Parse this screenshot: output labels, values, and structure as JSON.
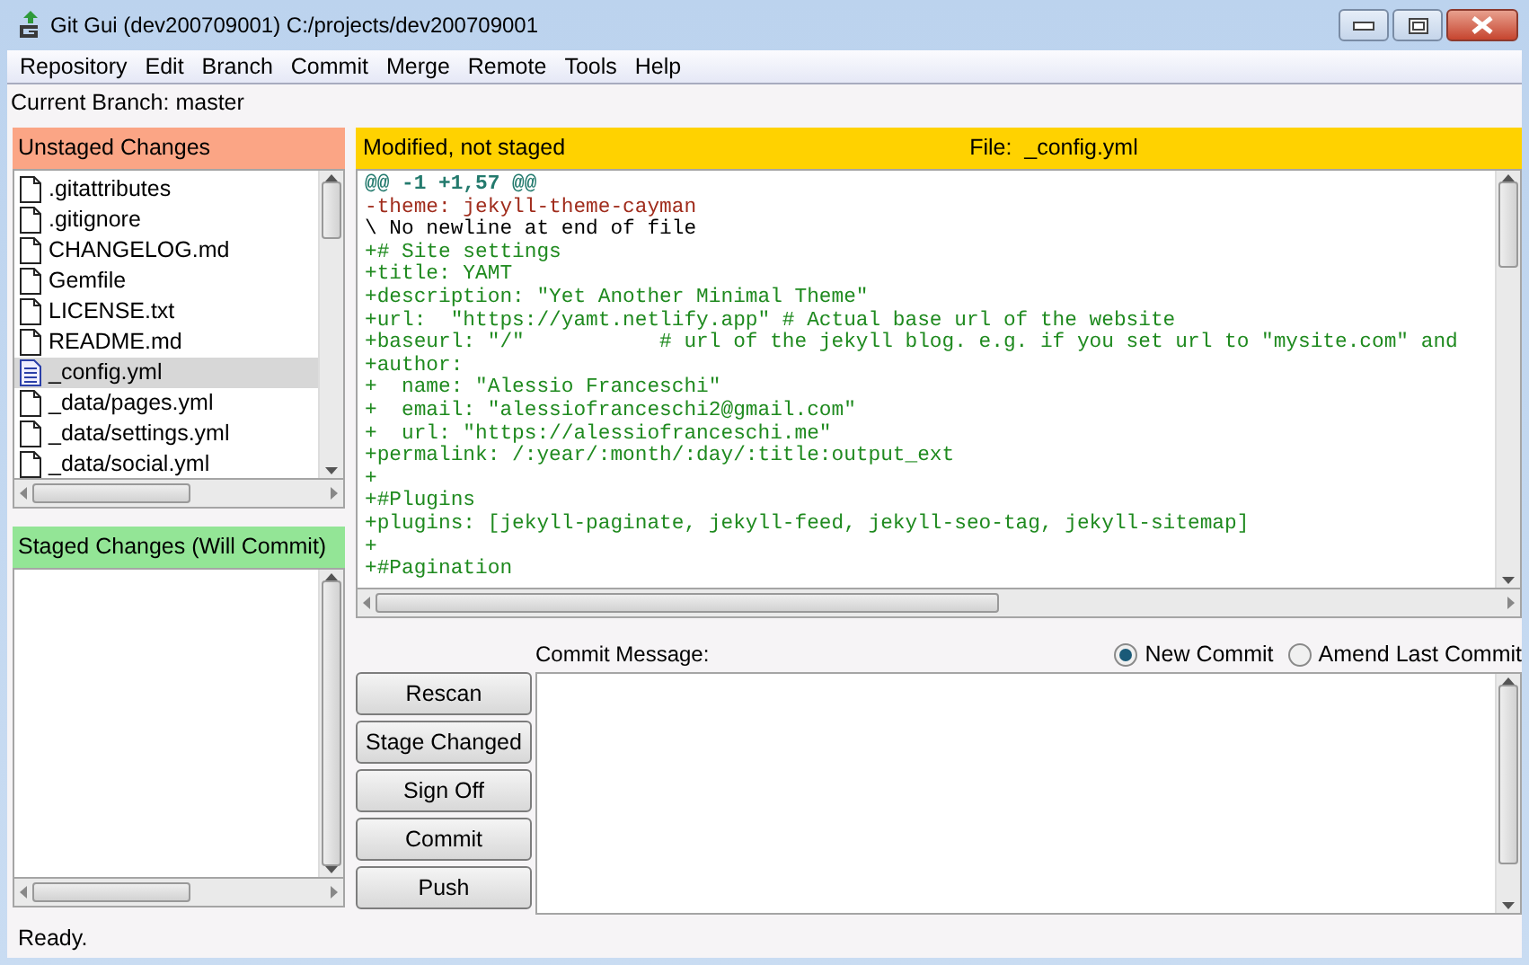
{
  "window": {
    "title": "Git Gui (dev200709001) C:/projects/dev200709001"
  },
  "menu": [
    "Repository",
    "Edit",
    "Branch",
    "Commit",
    "Merge",
    "Remote",
    "Tools",
    "Help"
  ],
  "current_branch": "Current Branch: master",
  "unstaged": {
    "title": "Unstaged Changes",
    "files": [
      {
        "name": ".gitattributes",
        "selected": false
      },
      {
        "name": ".gitignore",
        "selected": false
      },
      {
        "name": "CHANGELOG.md",
        "selected": false
      },
      {
        "name": "Gemfile",
        "selected": false
      },
      {
        "name": "LICENSE.txt",
        "selected": false
      },
      {
        "name": "README.md",
        "selected": false
      },
      {
        "name": "_config.yml",
        "selected": true
      },
      {
        "name": "_data/pages.yml",
        "selected": false
      },
      {
        "name": "_data/settings.yml",
        "selected": false
      },
      {
        "name": "_data/social.yml",
        "selected": false
      }
    ]
  },
  "staged": {
    "title": "Staged Changes (Will Commit)"
  },
  "diff": {
    "status": "Modified, not staged",
    "file_label": "File:",
    "file": "_config.yml",
    "lines": [
      {
        "kind": "hunk",
        "text": "@@ -1 +1,57 @@"
      },
      {
        "kind": "removed",
        "text": "-theme: jekyll-theme-cayman"
      },
      {
        "kind": "context",
        "text": "\\ No newline at end of file"
      },
      {
        "kind": "added",
        "text": "+# Site settings"
      },
      {
        "kind": "added",
        "text": "+title: YAMT"
      },
      {
        "kind": "added",
        "text": "+description: \"Yet Another Minimal Theme\""
      },
      {
        "kind": "added",
        "text": "+url:  \"https://yamt.netlify.app\" # Actual base url of the website"
      },
      {
        "kind": "added",
        "text": "+baseurl: \"/\"           # url of the jekyll blog. e.g. if you set url to \"mysite.com\" and"
      },
      {
        "kind": "added",
        "text": "+author:"
      },
      {
        "kind": "added",
        "text": "+  name: \"Alessio Franceschi\""
      },
      {
        "kind": "added",
        "text": "+  email: \"alessiofranceschi2@gmail.com\""
      },
      {
        "kind": "added",
        "text": "+  url: \"https://alessiofranceschi.me\""
      },
      {
        "kind": "added",
        "text": "+permalink: /:year/:month/:day/:title:output_ext"
      },
      {
        "kind": "added",
        "text": "+"
      },
      {
        "kind": "added",
        "text": "+#Plugins"
      },
      {
        "kind": "added",
        "text": "+plugins: [jekyll-paginate, jekyll-feed, jekyll-seo-tag, jekyll-sitemap]"
      },
      {
        "kind": "added",
        "text": "+"
      },
      {
        "kind": "added",
        "text": "+#Pagination"
      }
    ]
  },
  "commit": {
    "label": "Commit Message:",
    "options": [
      {
        "label": "New Commit",
        "selected": true
      },
      {
        "label": "Amend Last Commit",
        "selected": false
      }
    ],
    "buttons": [
      "Rescan",
      "Stage Changed",
      "Sign Off",
      "Commit",
      "Push"
    ]
  },
  "status_bar": "Ready."
}
